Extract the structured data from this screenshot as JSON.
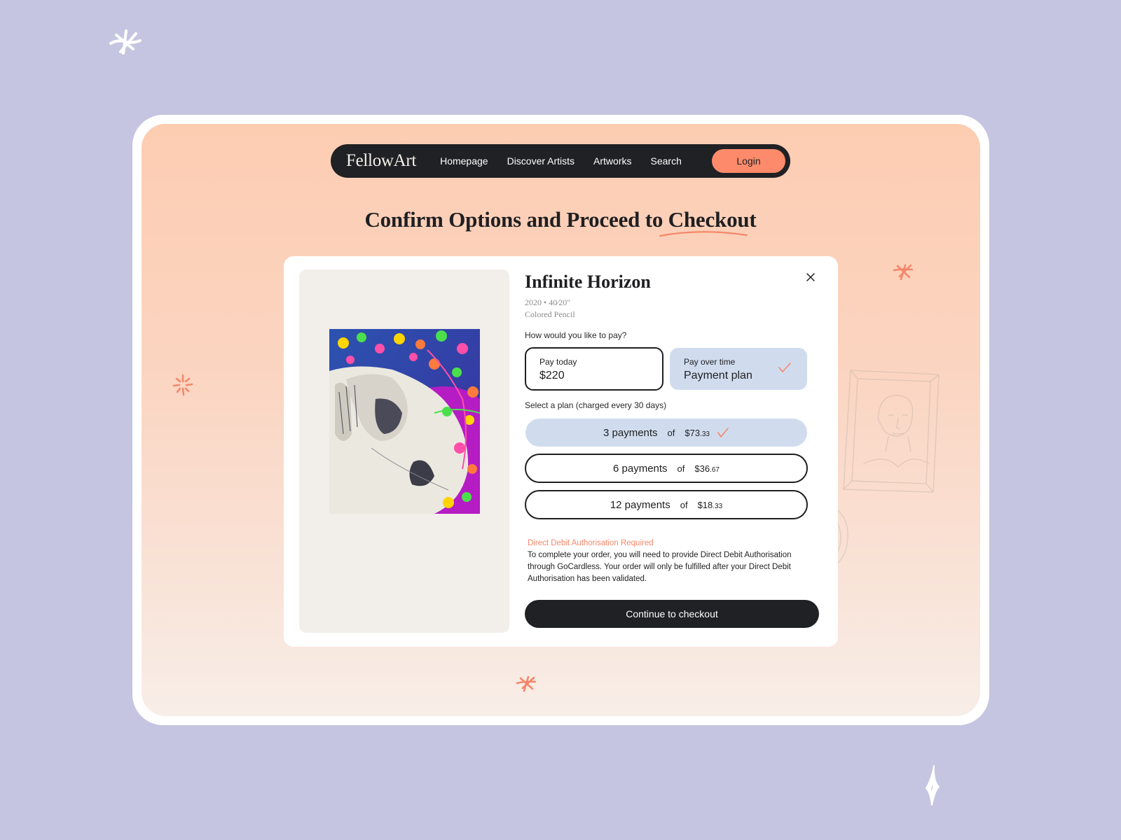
{
  "brand": {
    "logo": "FellowArt",
    "accent_color": "#fd8a6a",
    "selected_color": "#d0dcee",
    "dark_color": "#202124",
    "background_color": "#c5c5e1"
  },
  "nav": {
    "links": [
      "Homepage",
      "Discover Artists",
      "Artworks",
      "Search"
    ],
    "login_label": "Login"
  },
  "page": {
    "title": "Confirm Options and Proceed to Checkout"
  },
  "artwork": {
    "title": "Infinite Horizon",
    "meta_line": "2020 • 40⁄20\"",
    "medium": "Colored Pencil",
    "image_icon": "artwork-image"
  },
  "payment": {
    "question": "How would you like to pay?",
    "options": [
      {
        "small": "Pay today",
        "big": "$220",
        "selected": false
      },
      {
        "small": "Pay over time",
        "big": "Payment plan",
        "selected": true
      }
    ],
    "plan_label": "Select a plan (charged every 30 days)",
    "plans": [
      {
        "count": "3 payments",
        "of": "of",
        "dollars": "$73",
        "cents": ".33",
        "selected": true
      },
      {
        "count": "6 payments",
        "of": "of",
        "dollars": "$36",
        "cents": ".67",
        "selected": false
      },
      {
        "count": "12 payments",
        "of": "of",
        "dollars": "$18",
        "cents": ".33",
        "selected": false
      }
    ]
  },
  "notice": {
    "title": "Direct Debit Authorisation Required",
    "body": "To complete your order, you will need to provide Direct Debit Authorisation through GoCardless. Your order will only be fulfilled after your Direct Debit Authorisation has been validated."
  },
  "actions": {
    "continue_label": "Continue to checkout",
    "close_icon": "close-icon"
  }
}
